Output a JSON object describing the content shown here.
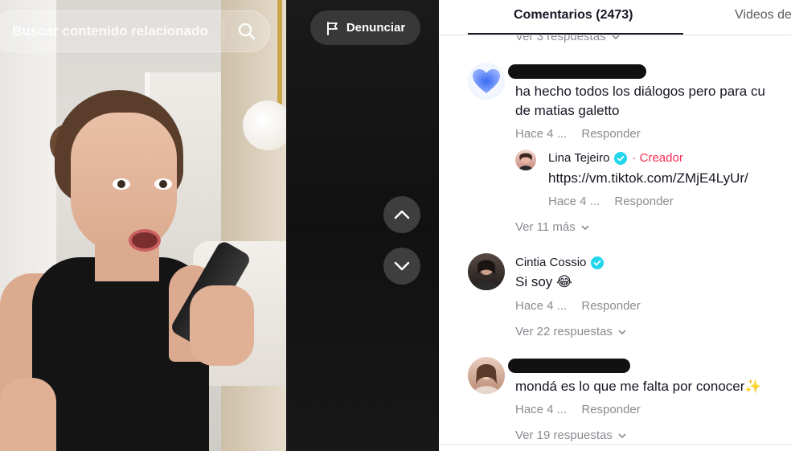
{
  "video": {
    "search_placeholder": "Buscar contenido relacionado",
    "report_label": "Denunciar"
  },
  "panel": {
    "tabs": [
      {
        "label": "Comentarios (2473)",
        "active": true
      },
      {
        "label": "Videos de",
        "active": false
      }
    ],
    "top_view_more": "Ver 3 respuestas",
    "comments": [
      {
        "text_line1": "ha hecho todos los diálogos pero para cu",
        "text_line2": "de matias galetto",
        "time": "Hace 4 ...",
        "reply": "Responder",
        "reply_item": {
          "author": "Lina Tejeiro",
          "tag": "· Creador",
          "text": "https://vm.tiktok.com/ZMjE4LyUr/",
          "time": "Hace 4 ...",
          "reply": "Responder"
        },
        "view_more": "Ver 11 más"
      },
      {
        "author": "Cintia Cossio",
        "text": "Si soy 😂",
        "time": "Hace 4 ...",
        "reply": "Responder",
        "view_more": "Ver 22 respuestas"
      },
      {
        "text": "mondá es lo que me falta por conocer✨",
        "time": "Hace 4 ...",
        "reply": "Responder",
        "view_more": "Ver 19 respuestas"
      }
    ]
  },
  "colors": {
    "creator_accent": "#fe2c55",
    "verified": "#20d5ec",
    "muted_text": "#8a8b91"
  }
}
